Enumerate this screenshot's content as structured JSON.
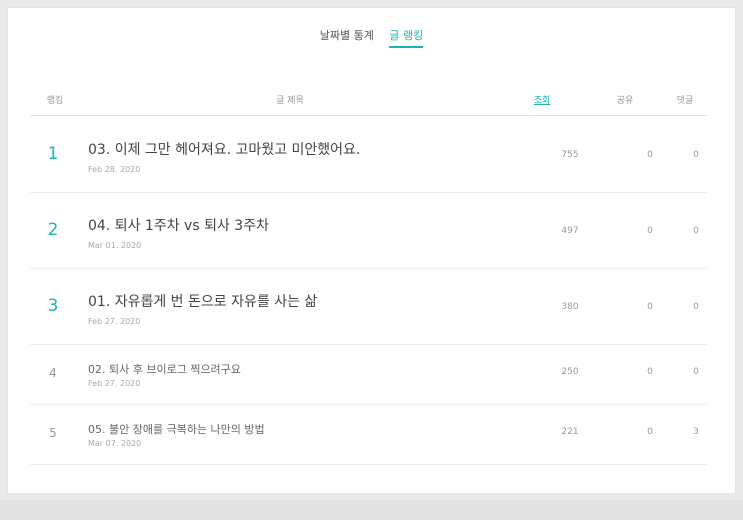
{
  "tabs": [
    {
      "label": "날짜별 통계"
    },
    {
      "label": "글 랭킹"
    }
  ],
  "table": {
    "headers": {
      "rank": "랭킹",
      "title": "글 제목",
      "views": "조회",
      "share": "공유",
      "comments": "댓글"
    },
    "rows": [
      {
        "rank": "1",
        "title": "03. 이제 그만 헤어져요. 고마웠고 미안했어요.",
        "date": "Feb 28. 2020",
        "views": "755",
        "share": "0",
        "comments": "0"
      },
      {
        "rank": "2",
        "title": "04. 퇴사 1주차 vs 퇴사 3주차",
        "date": "Mar 01. 2020",
        "views": "497",
        "share": "0",
        "comments": "0"
      },
      {
        "rank": "3",
        "title": "01. 자유롭게 번 돈으로 자유를 사는 삶",
        "date": "Feb 27. 2020",
        "views": "380",
        "share": "0",
        "comments": "0"
      },
      {
        "rank": "4",
        "title": "02. 퇴사 후 브이로그 찍으려구요",
        "date": "Feb 27. 2020",
        "views": "250",
        "share": "0",
        "comments": "0"
      },
      {
        "rank": "5",
        "title": "05. 불안 장애를 극복하는 나만의 방법",
        "date": "Mar 07. 2020",
        "views": "221",
        "share": "0",
        "comments": "3"
      }
    ]
  },
  "colors": {
    "accent": "#19b5b0",
    "text_primary": "#444444",
    "text_muted": "#999999"
  }
}
